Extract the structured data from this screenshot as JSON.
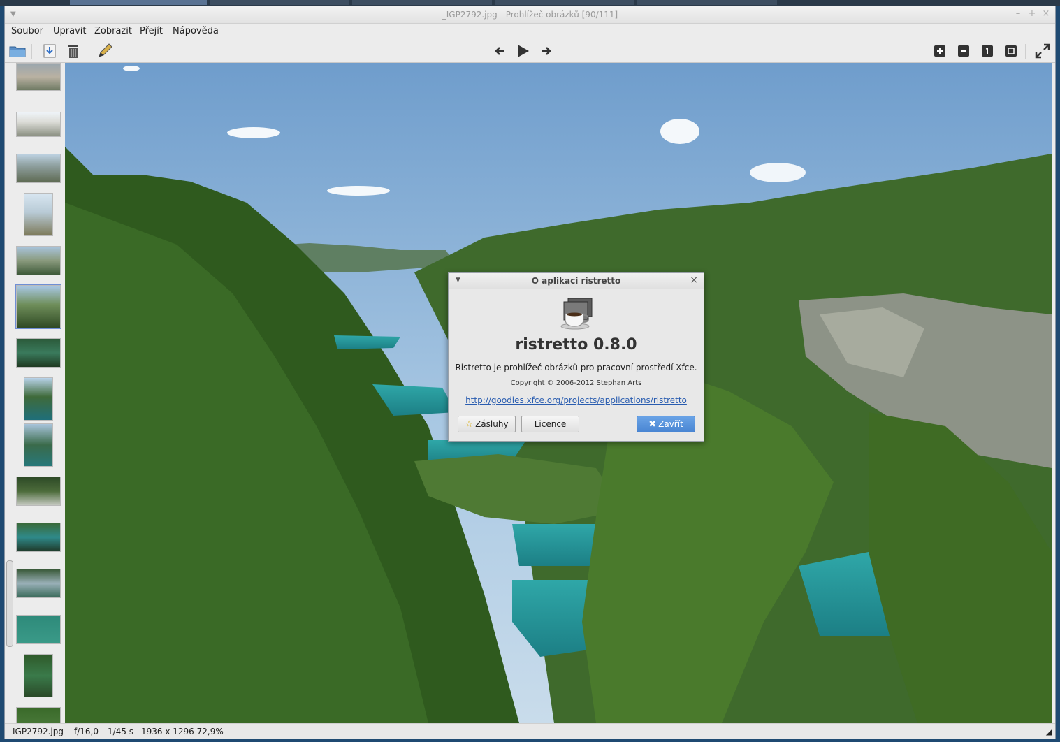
{
  "window": {
    "title": "_IGP2792.jpg - Prohlížeč obrázků [90/111]"
  },
  "menubar": {
    "items": [
      "Soubor",
      "Upravit",
      "Zobrazit",
      "Přejít",
      "Nápověda"
    ]
  },
  "toolbar": {
    "left_icons": [
      "folder-open-icon",
      "save-icon",
      "trash-icon",
      "edit-icon"
    ],
    "center_icons": [
      "arrow-left-icon",
      "play-icon",
      "arrow-right-icon"
    ],
    "right_icons": [
      "zoom-in-icon",
      "zoom-out-icon",
      "zoom-100-icon",
      "zoom-fit-icon",
      "fullscreen-icon"
    ]
  },
  "statusbar": {
    "filename": "_IGP2792.jpg",
    "aperture": "f/16,0",
    "exposure": "1/45 s",
    "dimensions": "1936 x 1296 72,9%"
  },
  "about_dialog": {
    "title": "O aplikaci ristretto",
    "app_name": "ristretto 0.8.0",
    "description": "Ristretto je prohlížeč obrázků pro pracovní prostředí Xfce.",
    "copyright": "Copyright © 2006-2012 Stephan Arts",
    "link": "http://goodies.xfce.org/projects/applications/ristretto",
    "buttons": {
      "credits": "Zásluhy",
      "license": "Licence",
      "close": "Zavřít"
    }
  },
  "colors": {
    "accent": "#4a86d3",
    "link": "#2a5db0"
  }
}
